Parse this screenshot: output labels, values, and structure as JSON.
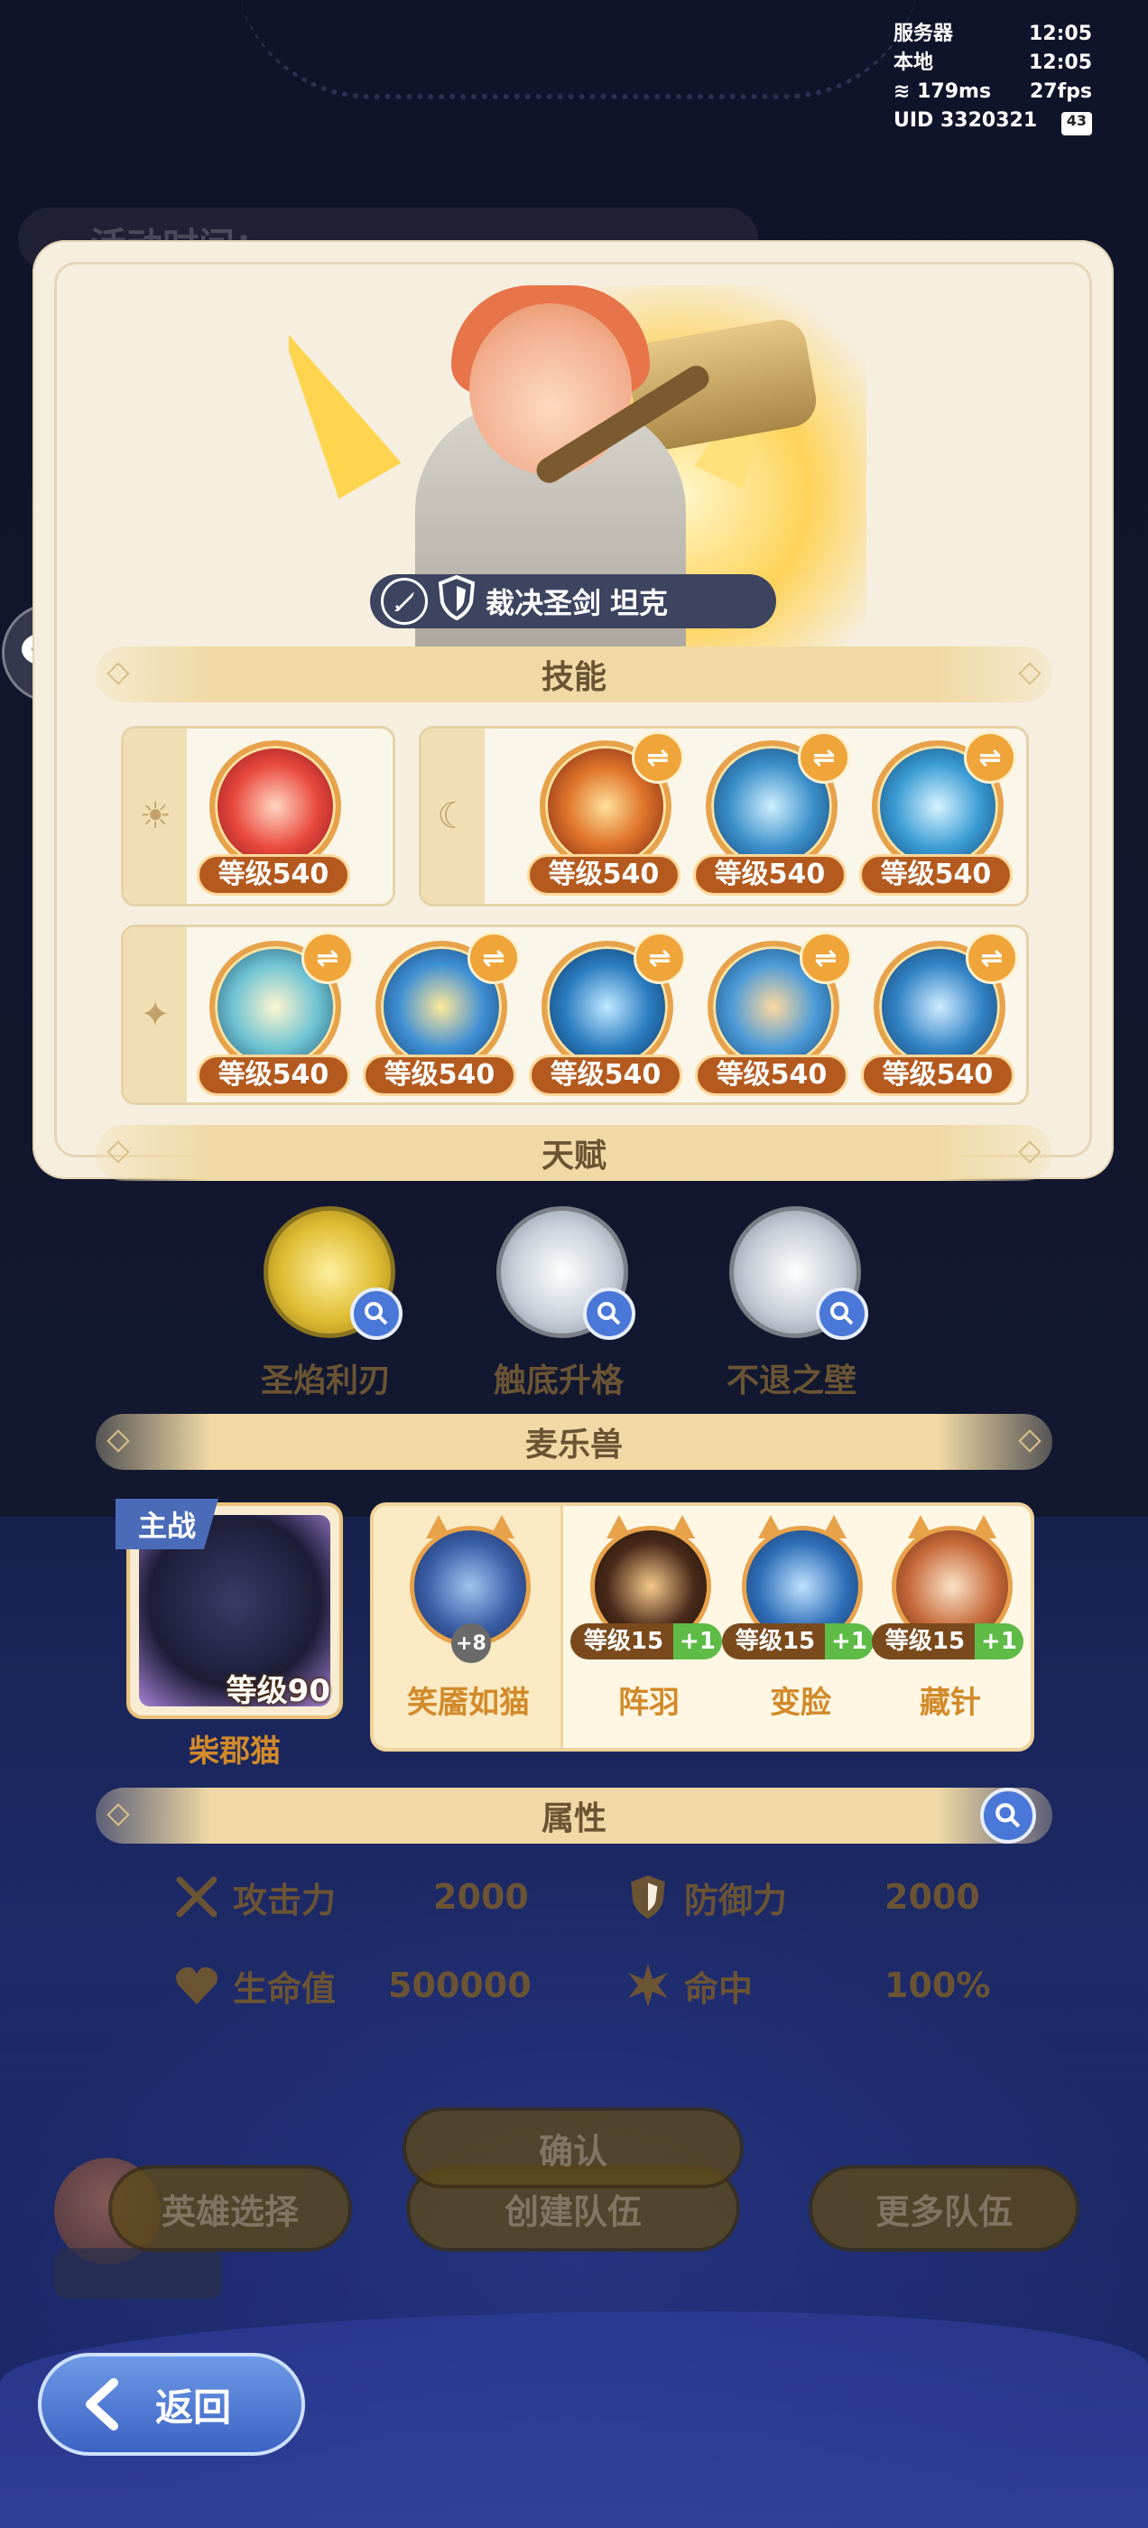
{
  "status": {
    "server_label": "服务器",
    "server_time": "12:05",
    "local_label": "本地",
    "local_time": "12:05",
    "ping": "179ms",
    "fps": "27fps",
    "uid": "UID 3320321",
    "battery": "43"
  },
  "hero": {
    "title": "裁决圣剑",
    "role": "坦克"
  },
  "sections": {
    "skills": "技能",
    "talents": "天赋",
    "pets": "麦乐兽",
    "attributes": "属性"
  },
  "skills": {
    "level_text": "等级540",
    "sun_group": [
      "等级540"
    ],
    "moon_group": [
      "等级540",
      "等级540",
      "等级540"
    ],
    "star_group": [
      "等级540",
      "等级540",
      "等级540",
      "等级540",
      "等级540"
    ],
    "group_icons": {
      "sun": "sun-icon",
      "moon": "moon-icon",
      "star": "star-icon"
    }
  },
  "talents": [
    {
      "name": "圣焰利刃",
      "color": "#d8b233",
      "icon": "lion-crest-icon"
    },
    {
      "name": "触底升格",
      "color": "#a9b4c2",
      "icon": "crystal-flower-icon"
    },
    {
      "name": "不退之壁",
      "color": "#a9b4c2",
      "icon": "shield-crest-icon"
    }
  ],
  "pets": {
    "main_tag": "主战",
    "main_name": "柴郡猫",
    "main_level": "等级90",
    "list": [
      {
        "name": "笑靥如猫",
        "badge": "+8"
      },
      {
        "name": "阵羽",
        "level": "等级15",
        "plus": "+1"
      },
      {
        "name": "变脸",
        "level": "等级15",
        "plus": "+1"
      },
      {
        "name": "藏针",
        "level": "等级15",
        "plus": "+1"
      }
    ]
  },
  "attributes": {
    "attack_label": "攻击力",
    "attack_value": "2000",
    "defense_label": "防御力",
    "defense_value": "2000",
    "hp_label": "生命值",
    "hp_value": "500000",
    "hit_label": "命中",
    "hit_value": "100%"
  },
  "background": {
    "confirm": "确认",
    "create_team": "创建队伍",
    "hero_select": "英雄选择",
    "more_teams": "更多队伍",
    "event_time": "活动时间："
  },
  "back_button": "返回"
}
